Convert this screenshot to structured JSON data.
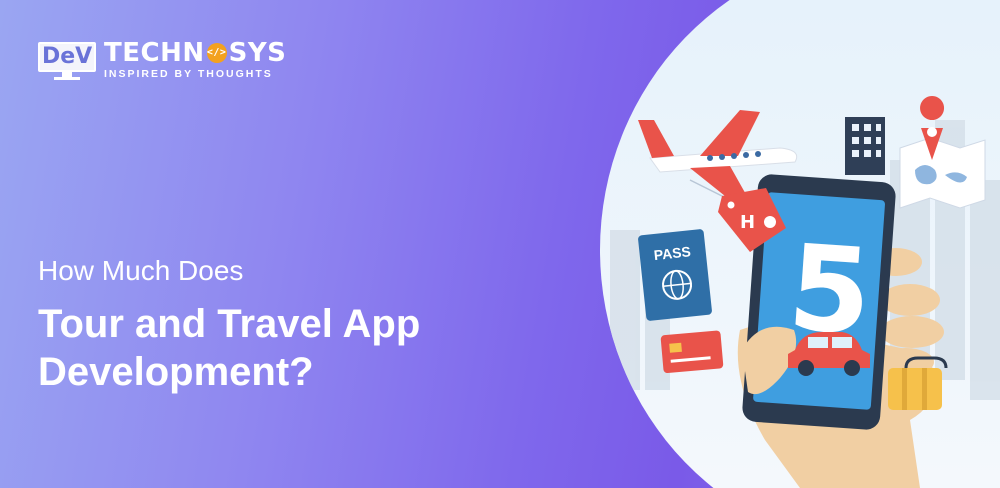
{
  "logo": {
    "mark_text": "DeV",
    "brand_before": "TECHN",
    "brand_o": "</>",
    "brand_after": "SYS",
    "tagline": "INSPIRED BY THOUGHTS"
  },
  "headline": {
    "eyebrow": "How Much Does",
    "line1": "Tour and Travel App",
    "line2": "Development?"
  },
  "illustration": {
    "phone_number": "5",
    "passport_label": "PASS",
    "hotel_tag": "H"
  },
  "colors": {
    "brand_orange": "#f3a11f",
    "gradient_left": "#9aa6f2",
    "gradient_right": "#7a5ae8",
    "phone_screen": "#3f9ee0",
    "tag_red": "#e8434a"
  },
  "icons": [
    "airplane-icon",
    "building-icon",
    "map-pin-icon",
    "passport-icon",
    "credit-card-icon",
    "car-icon",
    "luggage-icon",
    "hotel-tag-icon"
  ]
}
